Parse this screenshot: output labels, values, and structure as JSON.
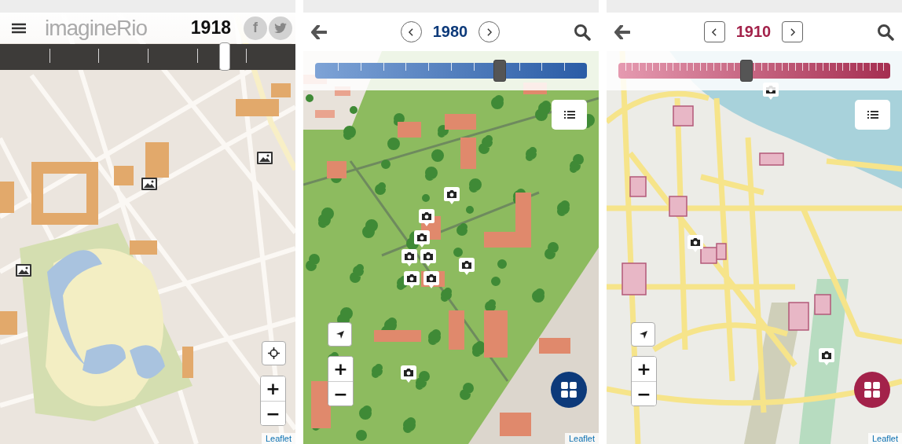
{
  "screens": [
    {
      "kind": "rio",
      "brand": "imagineRio",
      "year": "1918",
      "timeline": {
        "level": 0.76
      },
      "share": [
        {
          "kind": "facebook",
          "glyph": "f"
        },
        {
          "kind": "twitter"
        }
      ],
      "zoom": [
        "+",
        "−"
      ],
      "attribution": "Leaflet"
    },
    {
      "kind": "campus",
      "year": "1980",
      "timeline": {
        "level": 0.68
      },
      "zoom": [
        "+",
        "−"
      ],
      "attribution": "Leaflet"
    },
    {
      "kind": "oldtown",
      "year": "1910",
      "timeline": {
        "level": 0.47
      },
      "zoom": [
        "+",
        "−"
      ],
      "attribution": "Leaflet"
    }
  ]
}
